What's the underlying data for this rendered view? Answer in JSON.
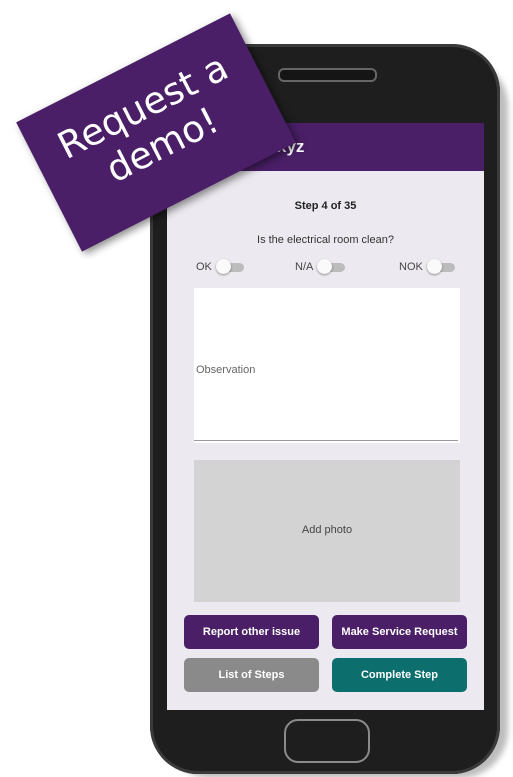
{
  "banner": {
    "line1": "Request a",
    "line2": "demo!"
  },
  "app_bar": {
    "title_visible": "xyz"
  },
  "checklist": {
    "step": "Step 4 of 35",
    "question": "Is the electrical room clean?",
    "options": [
      {
        "label": "OK",
        "on": false
      },
      {
        "label": "N/A",
        "on": false
      },
      {
        "label": "NOK",
        "on": false
      }
    ],
    "observation_label": "Observation",
    "add_photo_label": "Add photo"
  },
  "actions": {
    "report_other_issue": "Report other issue",
    "make_service_request": "Make Service Request",
    "list_of_steps": "List of Steps",
    "complete_step": "Complete Step"
  },
  "colors": {
    "brand_purple": "#4a1f67",
    "teal": "#0c6f6d",
    "gray_button": "#8a8a8a",
    "screen_bg": "#eceaf0"
  }
}
